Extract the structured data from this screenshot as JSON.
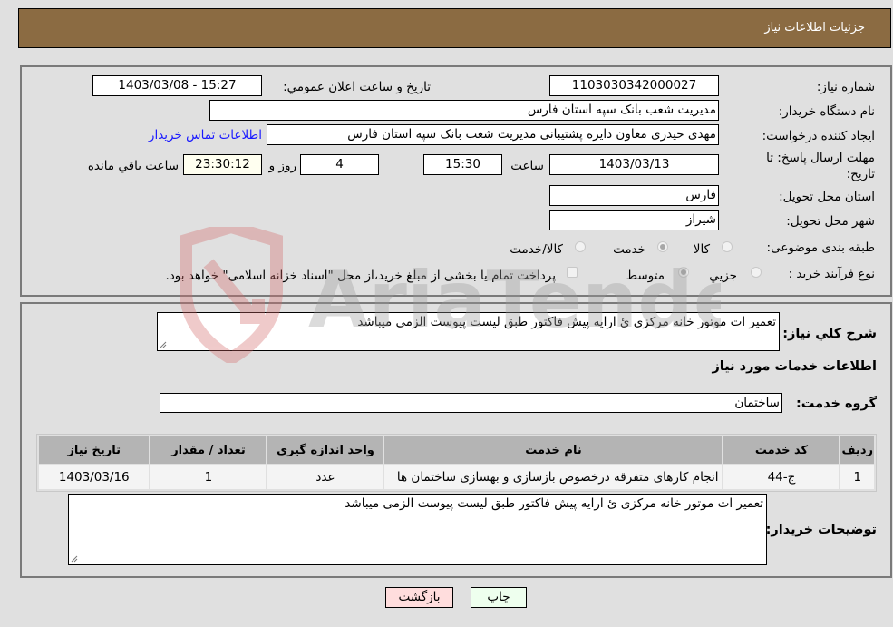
{
  "header": {
    "title": "جزئیات اطلاعات نیاز"
  },
  "form": {
    "need_number": {
      "label": "شماره نیاز:",
      "value": "1103030342000027"
    },
    "announce_datetime": {
      "label": "تاریخ و ساعت اعلان عمومي:",
      "value": "1403/03/08 - 15:27"
    },
    "buyer_org": {
      "label": "نام دستگاه خریدار:",
      "value": "مدیریت شعب بانک سپه استان فارس"
    },
    "requester": {
      "label": "ایجاد کننده درخواست:",
      "value": "مهدی حیدری معاون دایره پشتیبانی مدیریت شعب بانک سپه استان فارس"
    },
    "buyer_contact_link": "اطلاعات تماس خریدار",
    "deadline": {
      "label_line1": "مهلت ارسال پاسخ: تا",
      "label_line2": "تاریخ:",
      "date": "1403/03/13",
      "time_label": "ساعت",
      "time": "15:30",
      "days": "4",
      "days_label": "روز و",
      "remaining": "23:30:12",
      "remaining_label": "ساعت باقي مانده"
    },
    "delivery_province": {
      "label": "استان محل تحویل:",
      "value": "فارس"
    },
    "delivery_city": {
      "label": "شهر محل تحویل:",
      "value": "شیراز"
    },
    "category": {
      "label": "طبقه بندی موضوعی:",
      "options": [
        {
          "label": "کالا",
          "checked": false
        },
        {
          "label": "خدمت",
          "checked": true
        },
        {
          "label": "کالا/خدمت",
          "checked": false
        }
      ]
    },
    "purchase_type": {
      "label": "نوع فرآیند خرید :",
      "options": [
        {
          "label": "جزیي",
          "checked": false
        },
        {
          "label": "متوسط",
          "checked": true
        }
      ],
      "payment_checkbox_checked": false,
      "payment_note": "پرداخت تمام یا بخشی از مبلغ خرید،از محل \"اسناد خزانه اسلامی\" خواهد بود."
    }
  },
  "details": {
    "summary_label": "شرح کلي نیاز:",
    "summary_value": "تعمیر ات موتور خانه مرکزی ئ ارایه پیش فاکتور طبق لیست پیوست الزمی میباشد",
    "services_heading": "اطلاعات خدمات مورد نیاز",
    "service_group_label": "گروه خدمت:",
    "service_group_value": "ساختمان",
    "table": {
      "headers": [
        "ردیف",
        "کد خدمت",
        "نام خدمت",
        "واحد اندازه گیری",
        "تعداد / مقدار",
        "تاریخ نیاز"
      ],
      "rows": [
        [
          "1",
          "ج-44",
          "انجام کارهای متفرقه درخصوص بازسازی و بهسازی ساختمان ها",
          "عدد",
          "1",
          "1403/03/16"
        ]
      ]
    },
    "buyer_notes_label": "توضیحات خریدار:",
    "buyer_notes_value": "تعمیر ات موتور خانه مرکزی ئ ارایه پیش فاکتور طبق لیست پیوست الزمی میباشد"
  },
  "buttons": {
    "print": "چاپ",
    "back": "بازگشت"
  },
  "watermark": {
    "text": "AriaTender.neT"
  },
  "colors": {
    "header_bg": "#8b6b42",
    "link": "#1a1aff",
    "print_bg": "#eeffee",
    "back_bg": "#ffdddd"
  }
}
